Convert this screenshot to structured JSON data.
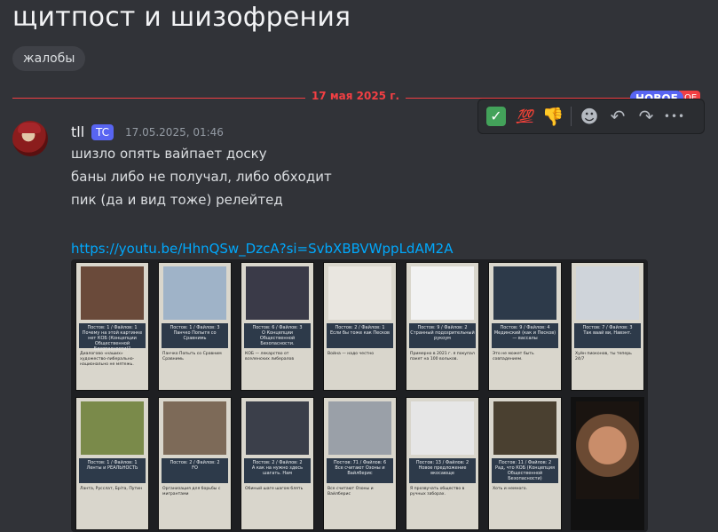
{
  "channel": {
    "title": "щитпост и шизофрения",
    "tag": "жалобы"
  },
  "divider": {
    "date": "17 мая 2025 г.",
    "new_label": "НОВОЕ",
    "new_tail": "ОЕ"
  },
  "hover_bar": {
    "items": [
      "white-check-mark",
      "hundred",
      "thumbs-down",
      "add-reaction",
      "reply",
      "forward",
      "more"
    ],
    "check": "✓",
    "hundred": "💯",
    "thumbs_down": "👎",
    "emoji": "☻",
    "reply": "↶",
    "forward": "↷",
    "more": "•••"
  },
  "message": {
    "author": "tll",
    "tag": "TC",
    "timestamp": "17.05.2025, 01:46",
    "lines": [
      "шизло опять вайпает доску",
      "баны либо не получал, либо обходит",
      "пик (да и вид тоже) релейтед"
    ],
    "link": "https://youtu.be/HhnQSw_DzcA?si=SvbXBBVWppLdAM2A"
  },
  "attachment": {
    "cards": [
      {
        "caption": "Постов: 1 / Файлов: 1\nПочему на этой картинке нет КОБ (Концепции Общественной Безопасности)?",
        "text": "Диалогово «наших» художество-либерально-национально не мятежь."
      },
      {
        "caption": "Постов: 1 / Файлов: 3\nПанчко Попытя со Сравнимь",
        "text": "Панчко Попыть со Сравним Сравнимь"
      },
      {
        "caption": "Постов: 6 / Файлов: 3\nО Концепции Общественной Безопасности.",
        "text": "КОБ — лекарство от вселенских либералов"
      },
      {
        "caption": "Постов: 2 / Файлов: 1\nЕсли бы тоже как Песков",
        "text": "Война — надо честно"
      },
      {
        "caption": "Постов: 9 / Файлов: 2\nСтранный подозрительный рукоум",
        "text": "Примерно в 2021 г. я покупал пакет на 100 вольков."
      },
      {
        "caption": "Постов: 9 / Файлов: 4\nМединский (как и Песков) — вассалы",
        "text": "Это не может быть совпадением."
      },
      {
        "caption": "Постов: 7 / Файлов: 3\nТак ваай ви, Навэнт.",
        "text": "Хуйн пиоконов, ты теперь 24/7"
      },
      {
        "caption": "Постов: 1 / Файлов: 1\nЛенты и РЕАЛЬНОСТЬ",
        "text": "Ланта, Русслат, Бріта, Путин"
      },
      {
        "caption": "Постов: 2 / Файлов: 2\nFO",
        "text": "Организация для борьбы с мигрантами"
      },
      {
        "caption": "Постов: 2 / Файлов: 2\nА как на нужно здесь шагать. Нам",
        "text": "Обиный шаге шагом блять"
      },
      {
        "caption": "Постов: 71 / Файлов: 6\nВсе считают Озоны и Вайлберис",
        "text": "Все считают Озоны и Вайлберис"
      },
      {
        "caption": "Постов: 13 / Файлов: 2\nНовое предложение вкосающе",
        "text": "Я прозвучать общество в ручных заборах."
      },
      {
        "caption": "Постов: 11 / Файлов: 2\nРад, что КОБ (Концепция Общественной Безопасности)",
        "text": "Хоть и немного."
      },
      {
        "caption": "Постов: 2 / Файлов: 1\n",
        "text": ""
      }
    ]
  },
  "colors": {
    "accent": "#5865f2",
    "new_red": "#f23f43",
    "link": "#00a8fc"
  }
}
